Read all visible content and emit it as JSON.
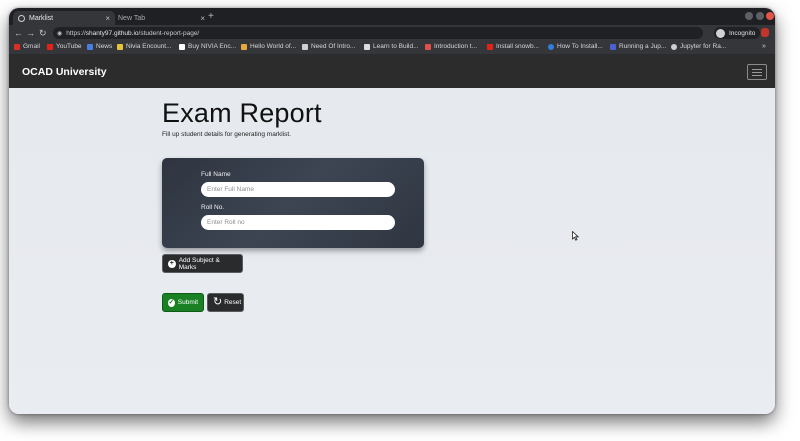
{
  "browser": {
    "tabs": [
      {
        "label": "Marklist",
        "active": true
      },
      {
        "label": "New Tab",
        "active": false
      }
    ],
    "url_prefix": "https://",
    "url_host": "shanty97.github.io",
    "url_path": "/student-report-page/",
    "incognito_label": "Incognito",
    "bookmarks": [
      {
        "label": "Gmail",
        "color": "#d93025"
      },
      {
        "label": "YouTube",
        "color": "#e62117"
      },
      {
        "label": "News",
        "color": "#4a7de0"
      },
      {
        "label": "Nivia Encount...",
        "color": "#e8c23a"
      },
      {
        "label": "Buy NIVIA Enc...",
        "color": "#ffffff"
      },
      {
        "label": "Hello World of...",
        "color": "#e8a73a"
      },
      {
        "label": "Need Of Intro...",
        "color": "#cfcfcf"
      },
      {
        "label": "Learn to Build...",
        "color": "#dddddd"
      },
      {
        "label": "Introduction t...",
        "color": "#e0504a"
      },
      {
        "label": "Install snowb...",
        "color": "#e62117"
      },
      {
        "label": "How To Install...",
        "color": "#2f7de1"
      },
      {
        "label": "Running a Jup...",
        "color": "#4a5fd0"
      },
      {
        "label": "Jupyter for Ra...",
        "color": "#cfcfcf"
      }
    ]
  },
  "navbar": {
    "brand": "OCAD University"
  },
  "page": {
    "title": "Exam Report",
    "subtitle": "Fill up student details for generating marklist."
  },
  "form": {
    "full_name_label": "Full Name",
    "full_name_placeholder": "Enter Full Name",
    "roll_label": "Roll No.",
    "roll_placeholder": "Enter Roll no"
  },
  "buttons": {
    "add_subject": "Add Subject & Marks",
    "submit": "Submit",
    "reset": "Reset"
  }
}
